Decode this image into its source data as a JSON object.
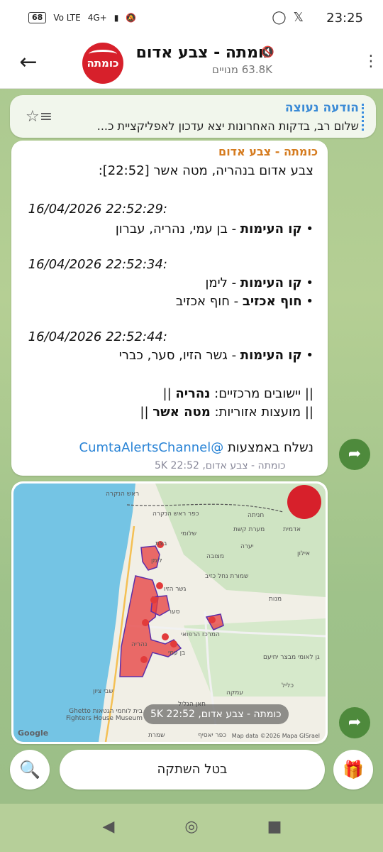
{
  "status": {
    "battery": "68",
    "net1": "Vo LTE",
    "net2": "4G+",
    "time": "23:25"
  },
  "header": {
    "title": "כומתה - צבע אדום",
    "subtitle": "63.8K מנויים",
    "avatar_text": "כומתה"
  },
  "pinned": {
    "label": "הודעה נעוצה",
    "text": "שלום רב, בדקות האחרונות יצא עדכון לאפליקציית כ..."
  },
  "message": {
    "sender": "כומתה - צבע אדום",
    "line1": "צבע אדום בנהריה, מטה אשר [22:52]:",
    "ts1": "16/04/2026 22:52:29:",
    "l1_bold": "קו העימות",
    "l1_rest": " - בן עמי, נהריה, עברון",
    "ts2": "16/04/2026 22:52:34:",
    "l2_bold": "קו העימות",
    "l2_rest": " - לימן",
    "l3_bold": "חוף אכזיב",
    "l3_rest": " - חוף אכזיב",
    "ts3": "16/04/2026 22:52:44:",
    "l4_bold": "קו העימות",
    "l4_rest": " - גשר הזיו, סער, כברי",
    "sum1_pre": "|| יישובים מרכזיים: ",
    "sum1_bold": "נהריה",
    "sum1_post": " ||",
    "sum2_pre": "|| מועצות אזוריות: ",
    "sum2_bold": "מטה אשר",
    "sum2_post": " ||",
    "sent_via": "נשלח באמצעות ",
    "channel": "@CumtaAlertsChannel",
    "meta": "כומתה - צבע אדום, 22:52  5K"
  },
  "photo": {
    "meta": "כומתה - צבע אדום, 22:52  5K",
    "google": "Google",
    "mapdata": "Map data ©2026 Mapa GISrael",
    "labels": [
      "ראש הנקרה",
      "כפר ראש הנקרה",
      "חניתה",
      "אדמית",
      "מערת קשת",
      "שלומי",
      "בצת",
      "יערה",
      "אילון",
      "מצובה",
      "לימן",
      "שמורת נחל כזיב",
      "גשר הזיו",
      "מנות",
      "סער",
      "נהריה",
      "בן עמי",
      "המרכז הרפואי",
      "גן לאומי מבצר יחיעם",
      "כליל",
      "שבי ציון",
      "עמקה",
      "חאן הגליל",
      "בית לוחמי הגטאות Ghetto Fighters House Museum",
      "שמרת",
      "כפר יאסיף"
    ]
  },
  "input": {
    "unmute_label": "בטל השתקה"
  }
}
